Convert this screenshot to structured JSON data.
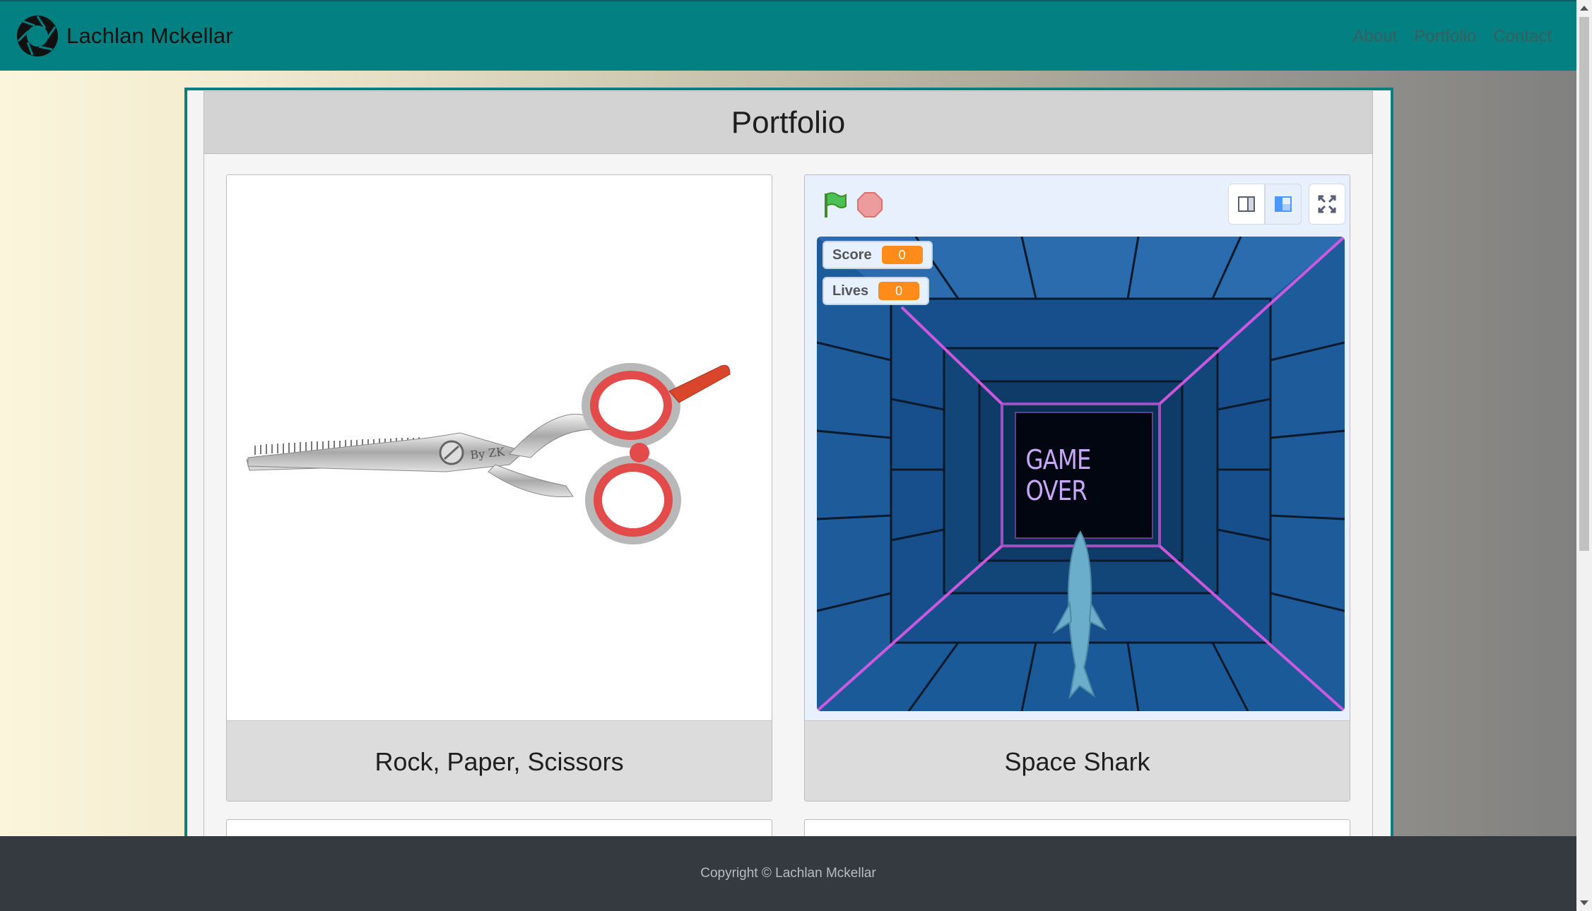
{
  "navbar": {
    "brand_name": "Lachlan Mckellar",
    "links": [
      "About",
      "Portfolio",
      "Contact"
    ],
    "background": "#038081"
  },
  "portfolio": {
    "title": "Portfolio",
    "cards": [
      {
        "title": "Rock, Paper, Scissors",
        "image": "scissors-image",
        "image_text": "By ZK"
      },
      {
        "title": "Space Shark",
        "image": "scratch-game-embed"
      }
    ]
  },
  "scratch_player": {
    "monitors": [
      {
        "label": "Score",
        "value": "0"
      },
      {
        "label": "Lives",
        "value": "0"
      }
    ],
    "stage_text": "GAME OVER",
    "icons": [
      "green-flag-icon",
      "stop-icon",
      "small-stage-icon",
      "large-stage-icon",
      "fullscreen-icon"
    ]
  },
  "footer": {
    "text": "Copyright © Lachlan Mckellar"
  },
  "colors": {
    "accent": "#038081",
    "footer": "#343a40",
    "monitor_value": "#ff8c1a"
  }
}
